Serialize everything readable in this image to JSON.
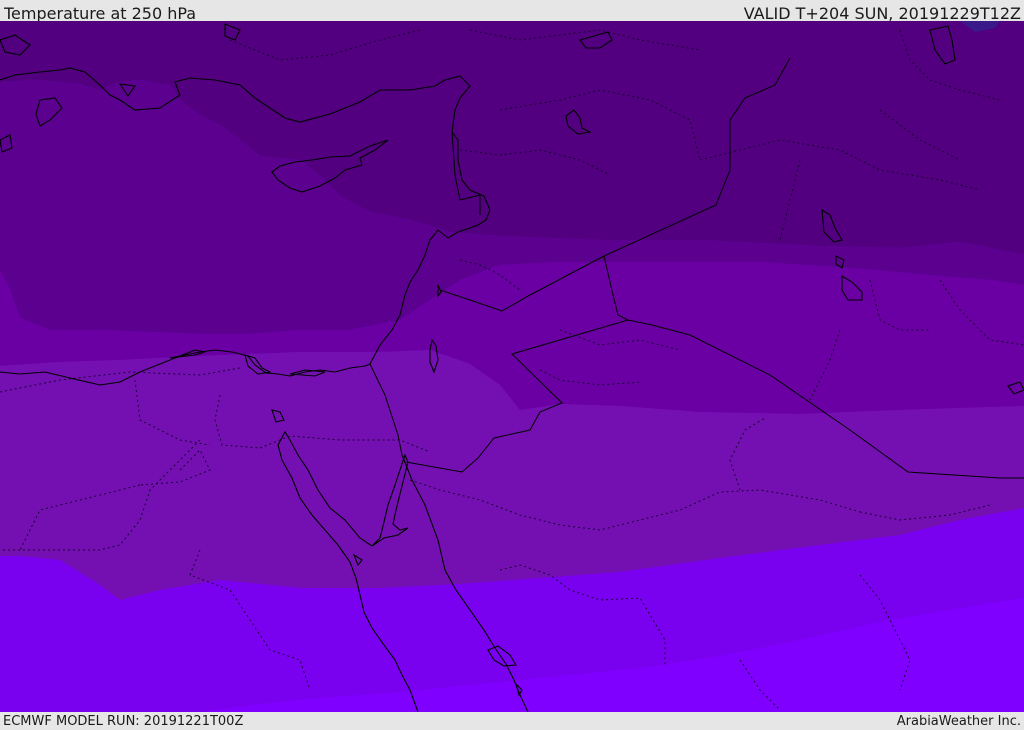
{
  "header": {
    "title": "Temperature at 250 hPa",
    "valid": "VALID T+204 SUN, 20191229T12Z"
  },
  "footer": {
    "model_run": "ECMWF MODEL RUN: 20191221T00Z",
    "credit": "ArabiaWeather Inc."
  },
  "colors": {
    "band_1": "#520080",
    "band_2": "#5c008f",
    "band_3": "#6a00a3",
    "band_4": "#7410b2",
    "band_5": "#7a00e0",
    "band_6": "#8000ff",
    "coast": "#000000",
    "border": "#1a0033"
  }
}
